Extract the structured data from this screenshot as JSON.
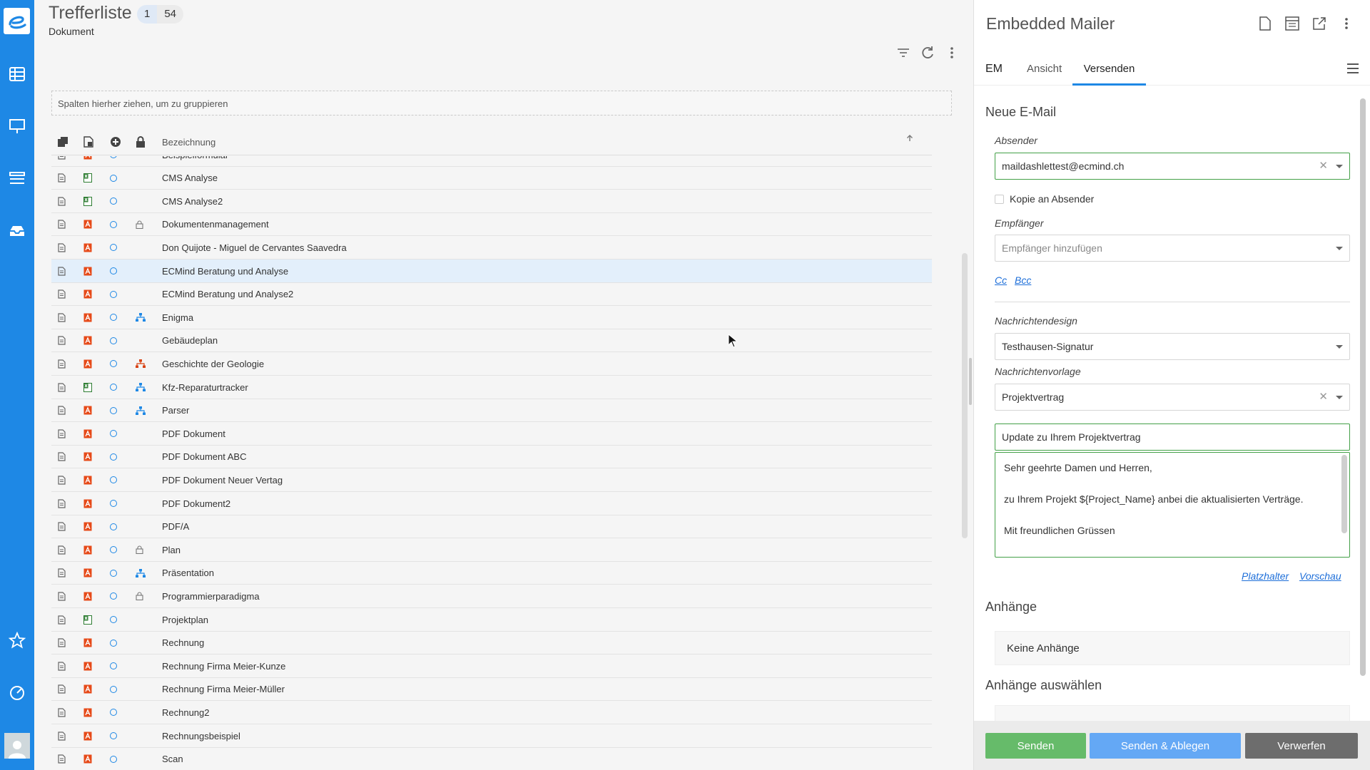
{
  "main": {
    "title": "Trefferliste",
    "badge_page": "1",
    "badge_count": "54",
    "subtitle": "Dokument",
    "group_hint": "Spalten hierher ziehen, um zu gruppieren",
    "column_header": "Bezeichnung",
    "rows": [
      {
        "name": "Beispielformular",
        "type": "pdf",
        "extra": ""
      },
      {
        "name": "CMS Analyse",
        "type": "xls",
        "extra": ""
      },
      {
        "name": "CMS Analyse2",
        "type": "xls",
        "extra": ""
      },
      {
        "name": "Dokumentenmanagement",
        "type": "pdf",
        "extra": "lock"
      },
      {
        "name": "Don Quijote - Miguel de Cervantes Saavedra",
        "type": "pdf",
        "extra": ""
      },
      {
        "name": "ECMind Beratung und Analyse",
        "type": "pdf",
        "extra": "",
        "selected": true
      },
      {
        "name": "ECMind Beratung und Analyse2",
        "type": "pdf",
        "extra": ""
      },
      {
        "name": "Enigma",
        "type": "pdf",
        "extra": "workflow-blue"
      },
      {
        "name": "Gebäudeplan",
        "type": "pdf",
        "extra": ""
      },
      {
        "name": "Geschichte der Geologie",
        "type": "pdf",
        "extra": "workflow-red"
      },
      {
        "name": "Kfz-Reparaturtracker",
        "type": "xls",
        "extra": "workflow-blue"
      },
      {
        "name": "Parser",
        "type": "pdf",
        "extra": "workflow-blue"
      },
      {
        "name": "PDF Dokument",
        "type": "pdf",
        "extra": ""
      },
      {
        "name": "PDF Dokument ABC",
        "type": "pdf",
        "extra": ""
      },
      {
        "name": "PDF Dokument Neuer Vertag",
        "type": "pdf",
        "extra": ""
      },
      {
        "name": "PDF Dokument2",
        "type": "pdf",
        "extra": ""
      },
      {
        "name": "PDF/A",
        "type": "pdf",
        "extra": ""
      },
      {
        "name": "Plan",
        "type": "pdf",
        "extra": "lock"
      },
      {
        "name": "Präsentation",
        "type": "pdf",
        "extra": "workflow-blue"
      },
      {
        "name": "Programmierparadigma",
        "type": "pdf",
        "extra": "lock"
      },
      {
        "name": "Projektplan",
        "type": "xls",
        "extra": ""
      },
      {
        "name": "Rechnung",
        "type": "pdf",
        "extra": ""
      },
      {
        "name": "Rechnung Firma Meier-Kunze",
        "type": "pdf",
        "extra": ""
      },
      {
        "name": "Rechnung Firma Meier-Müller",
        "type": "pdf",
        "extra": ""
      },
      {
        "name": "Rechnung2",
        "type": "pdf",
        "extra": ""
      },
      {
        "name": "Rechnungsbeispiel",
        "type": "pdf",
        "extra": ""
      },
      {
        "name": "Scan",
        "type": "pdf",
        "extra": ""
      }
    ]
  },
  "mailer": {
    "title": "Embedded Mailer",
    "tabs": {
      "em": "EM",
      "ansicht": "Ansicht",
      "versenden": "Versenden"
    },
    "section_new": "Neue E-Mail",
    "sender_label": "Absender",
    "sender_value": "maildashlettest@ecmind.ch",
    "copy_label": "Kopie an Absender",
    "recipient_label": "Empfänger",
    "recipient_placeholder": "Empfänger hinzufügen",
    "cc": "Cc",
    "bcc": "Bcc",
    "design_label": "Nachrichtendesign",
    "design_value": "Testhausen-Signatur",
    "template_label": "Nachrichtenvorlage",
    "template_value": "Projektvertrag",
    "subject_value": "Update zu Ihrem Projektvertrag",
    "body_lines": [
      "Sehr geehrte Damen und Herren,",
      "zu Ihrem Projekt ${Project_Name} anbei die aktualisierten Verträge.",
      "Mit freundlichen Grüssen"
    ],
    "placeholder_link": "Platzhalter",
    "preview_link": "Vorschau",
    "attachments_title": "Anhänge",
    "no_attachments": "Keine Anhänge",
    "choose_attachments_title": "Anhänge auswählen",
    "btn_send": "Senden",
    "btn_send_file": "Senden & Ablegen",
    "btn_discard": "Verwerfen"
  },
  "colors": {
    "accent": "#1e88e5",
    "pdf": "#d84315",
    "xls": "#2e7d32",
    "send": "#66bb6a",
    "send_file": "#64a8f5",
    "discard": "#6d6d6d"
  }
}
